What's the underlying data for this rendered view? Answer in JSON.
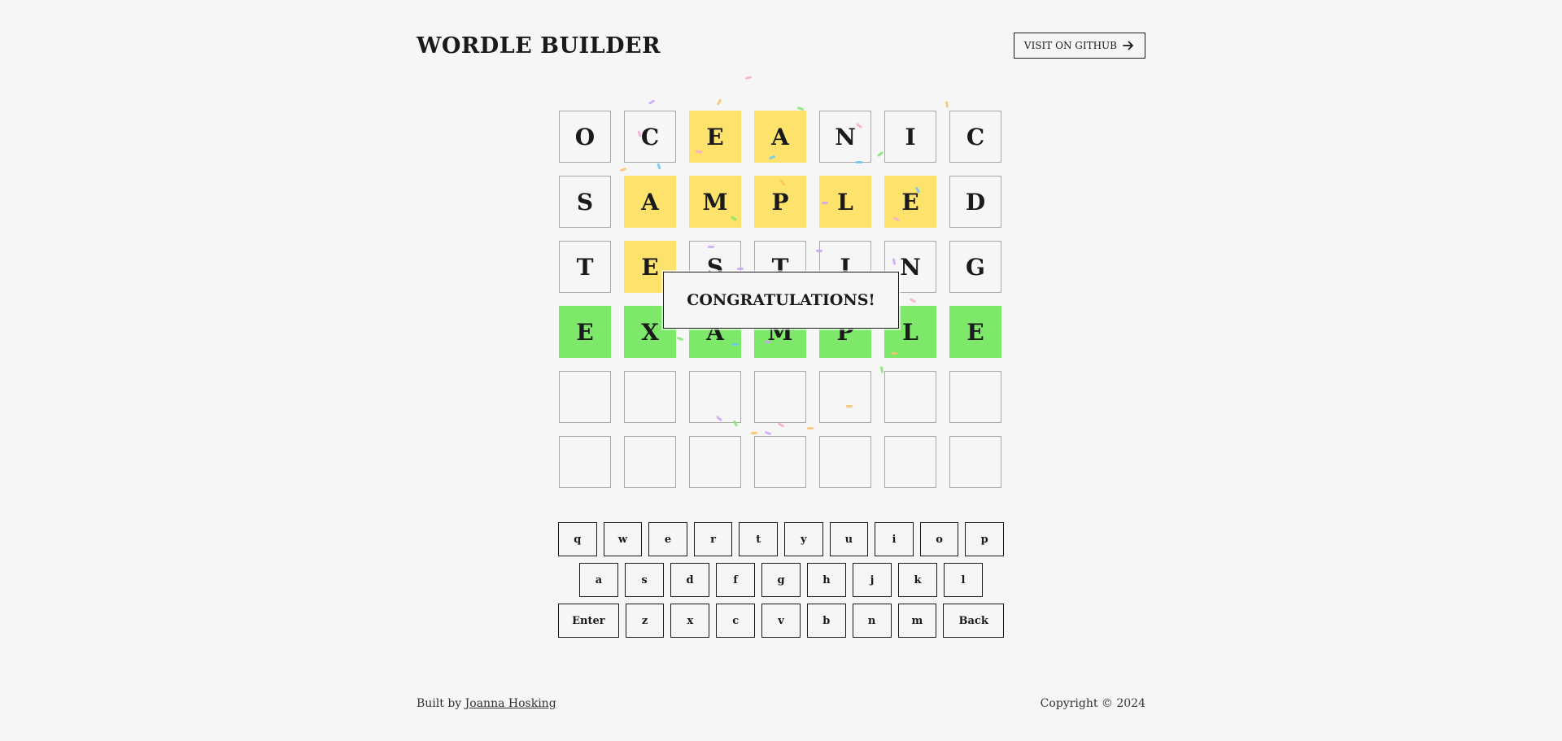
{
  "header": {
    "title": "WORDLE BUILDER",
    "github_label": "VISIT ON GITHUB"
  },
  "board": {
    "rows": [
      [
        {
          "l": "O",
          "s": "empty"
        },
        {
          "l": "C",
          "s": "empty"
        },
        {
          "l": "E",
          "s": "present"
        },
        {
          "l": "A",
          "s": "present"
        },
        {
          "l": "N",
          "s": "empty"
        },
        {
          "l": "I",
          "s": "empty"
        },
        {
          "l": "C",
          "s": "empty"
        }
      ],
      [
        {
          "l": "S",
          "s": "empty"
        },
        {
          "l": "A",
          "s": "present"
        },
        {
          "l": "M",
          "s": "present"
        },
        {
          "l": "P",
          "s": "present"
        },
        {
          "l": "L",
          "s": "present"
        },
        {
          "l": "E",
          "s": "present"
        },
        {
          "l": "D",
          "s": "empty"
        }
      ],
      [
        {
          "l": "T",
          "s": "empty"
        },
        {
          "l": "E",
          "s": "present"
        },
        {
          "l": "S",
          "s": "empty"
        },
        {
          "l": "T",
          "s": "empty"
        },
        {
          "l": "I",
          "s": "empty"
        },
        {
          "l": "N",
          "s": "empty"
        },
        {
          "l": "G",
          "s": "empty"
        }
      ],
      [
        {
          "l": "E",
          "s": "correct"
        },
        {
          "l": "X",
          "s": "correct"
        },
        {
          "l": "A",
          "s": "correct"
        },
        {
          "l": "M",
          "s": "correct"
        },
        {
          "l": "P",
          "s": "correct"
        },
        {
          "l": "L",
          "s": "correct"
        },
        {
          "l": "E",
          "s": "correct"
        }
      ],
      [
        {
          "l": "",
          "s": "empty"
        },
        {
          "l": "",
          "s": "empty"
        },
        {
          "l": "",
          "s": "empty"
        },
        {
          "l": "",
          "s": "empty"
        },
        {
          "l": "",
          "s": "empty"
        },
        {
          "l": "",
          "s": "empty"
        },
        {
          "l": "",
          "s": "empty"
        }
      ],
      [
        {
          "l": "",
          "s": "empty"
        },
        {
          "l": "",
          "s": "empty"
        },
        {
          "l": "",
          "s": "empty"
        },
        {
          "l": "",
          "s": "empty"
        },
        {
          "l": "",
          "s": "empty"
        },
        {
          "l": "",
          "s": "empty"
        },
        {
          "l": "",
          "s": "empty"
        }
      ]
    ],
    "colors": {
      "present": "#fde26b",
      "correct": "#7de86a"
    }
  },
  "message": "CONGRATULATIONS!",
  "keyboard": {
    "rows": [
      [
        "q",
        "w",
        "e",
        "r",
        "t",
        "y",
        "u",
        "i",
        "o",
        "p"
      ],
      [
        "a",
        "s",
        "d",
        "f",
        "g",
        "h",
        "j",
        "k",
        "l"
      ],
      [
        "Enter",
        "z",
        "x",
        "c",
        "v",
        "b",
        "n",
        "m",
        "Back"
      ]
    ]
  },
  "footer": {
    "built_by": "Built by",
    "author": "Joanna Hosking",
    "copyright": "Copyright © 2024"
  }
}
